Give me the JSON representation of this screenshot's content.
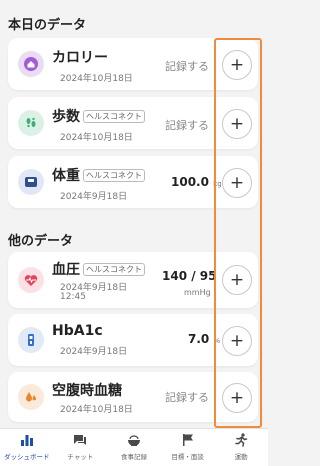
{
  "sections": {
    "today_title": "本日のデータ",
    "other_title": "他のデータ"
  },
  "cards": {
    "calorie": {
      "title": "カロリー",
      "date": "2024年10月18日",
      "action": "記録する",
      "icon": "house-icon"
    },
    "steps": {
      "title": "歩数",
      "tag": "ヘルスコネクト",
      "date": "2024年10月18日",
      "action": "記録する",
      "icon": "footprints-icon"
    },
    "weight": {
      "title": "体重",
      "tag": "ヘルスコネクト",
      "date": "2024年9月18日",
      "value": "100.0",
      "unit": "kg",
      "icon": "scale-icon"
    },
    "blood_pressure": {
      "title": "血圧",
      "tag": "ヘルスコネクト",
      "date": "2024年9月18日",
      "time": "12:45",
      "value": "140 / 95",
      "unit": "mmHg",
      "icon": "heart-pulse-icon"
    },
    "hba1c": {
      "title": "HbA1c",
      "date": "2024年9月18日",
      "value": "7.0",
      "unit": "%",
      "icon": "test-tube-icon"
    },
    "fasting_glucose": {
      "title": "空腹時血糖",
      "date": "2024年10月18日",
      "action": "記録する",
      "icon": "drops-icon"
    }
  },
  "add_label": "+",
  "tabs": [
    {
      "label": "ダッシュボード",
      "icon": "bar-chart-icon",
      "active": true
    },
    {
      "label": "チャット",
      "icon": "chat-icon",
      "active": false
    },
    {
      "label": "食事記録",
      "icon": "meal-icon",
      "active": false
    },
    {
      "label": "目標・面談",
      "icon": "flag-icon",
      "active": false
    },
    {
      "label": "運動",
      "icon": "running-icon",
      "active": false
    }
  ],
  "colors": {
    "accent": "#1f4ea8",
    "highlight": "#f08a3c",
    "calorie_bg": "#e9ddf5",
    "steps_bg": "#dcf1e6",
    "weight_bg": "#e2e7f5",
    "bp_bg": "#fbe1e4",
    "hba1c_bg": "#e2e9f7",
    "glucose_bg": "#fbead9"
  }
}
